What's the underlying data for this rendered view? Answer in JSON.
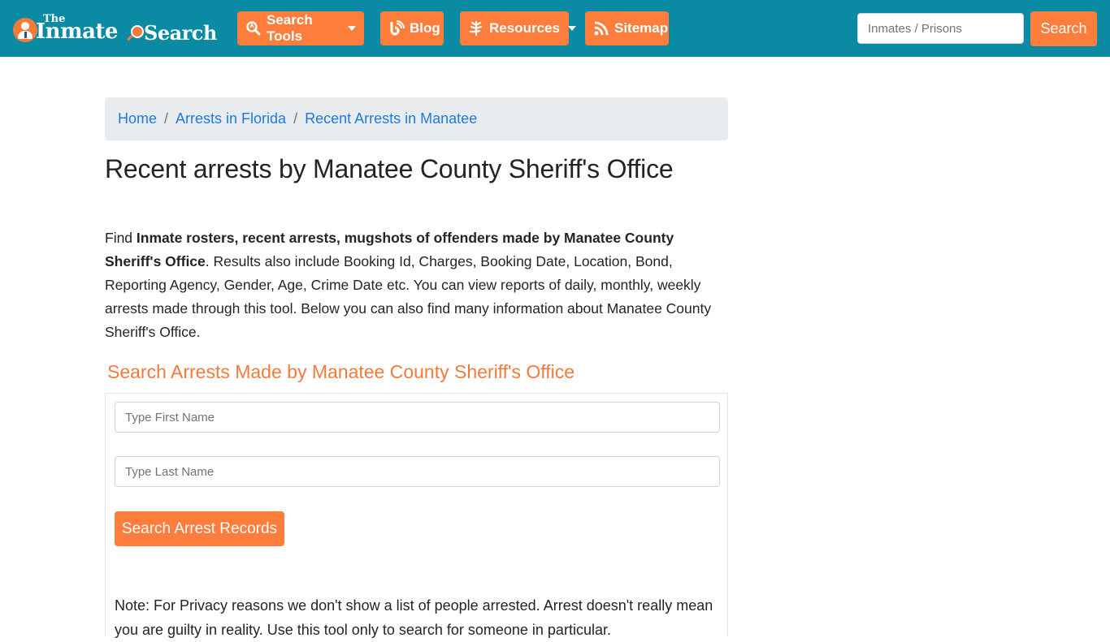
{
  "brand": {
    "logo_small": "The",
    "logo_main": "Inmate",
    "logo_tail": "Search"
  },
  "nav": {
    "items": [
      {
        "label": "Search Tools",
        "icon": "search-tools-icon",
        "dropdown": true
      },
      {
        "label": "Blog",
        "icon": "blog-icon",
        "dropdown": false
      },
      {
        "label": "Resources",
        "icon": "leaf-icon",
        "dropdown": true
      },
      {
        "label": "Sitemap",
        "icon": "rss-icon",
        "dropdown": false
      }
    ],
    "search_placeholder": "Inmates / Prisons",
    "search_value": "",
    "search_button": "Search"
  },
  "breadcrumb": [
    {
      "label": "Home"
    },
    {
      "label": "Arrests in Florida"
    },
    {
      "label": "Recent Arrests in Manatee"
    }
  ],
  "breadcrumb_separator": "/",
  "page": {
    "title": "Recent arrests by Manatee County Sheriff's Office",
    "intro_prefix": "Find ",
    "intro_bold": "Inmate rosters, recent arrests, mugshots of offenders made by Manatee County Sheriff's Office",
    "intro_rest": ". Results also include Booking Id, Charges, Booking Date, Location, Bond, Reporting Agency, Gender, Age, Crime Date etc. You can view reports of daily, monthly, weekly arrests made through this tool. Below you can also find many information about Manatee County Sheriff's Office."
  },
  "search_form": {
    "heading": "Search Arrests Made by Manatee County Sheriff's Office",
    "first_name_placeholder": "Type First Name",
    "first_name_value": "",
    "last_name_placeholder": "Type Last Name",
    "last_name_value": "",
    "submit_label": "Search Arrest Records",
    "note": "Note: For Privacy reasons we don't show a list of people arrested. Arrest doesn't really mean you are guilty in reality. Use this tool only to search for someone in particular."
  },
  "colors": {
    "navbar": "#0a8aa3",
    "accent": "#fd7e3c",
    "link": "#1f7ae0",
    "heading_accent": "#f47a3c"
  }
}
